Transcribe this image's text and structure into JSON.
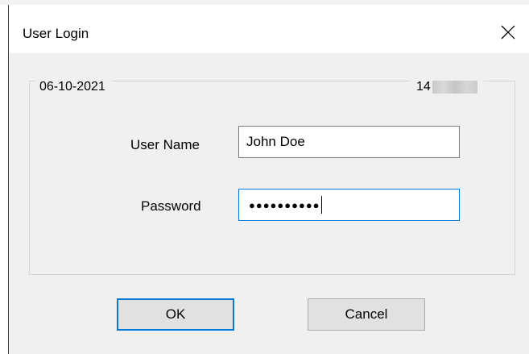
{
  "window": {
    "title": "User Login"
  },
  "group": {
    "date": "06-10-2021",
    "id_prefix": "14"
  },
  "form": {
    "username_label": "User Name",
    "username_value": "John Doe",
    "password_label": "Password",
    "password_masked": "●●●●●●●●●●"
  },
  "buttons": {
    "ok_label": "OK",
    "cancel_label": "Cancel"
  },
  "icons": {
    "close": "close-icon"
  },
  "colors": {
    "focus_accent": "#0078d7",
    "dialog_background": "#f0f0f0",
    "titlebar_background": "#ffffff"
  }
}
